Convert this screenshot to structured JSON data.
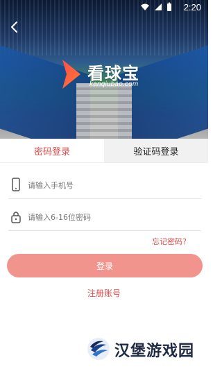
{
  "status_bar": {
    "time": "2:20",
    "icons": [
      "wifi-icon",
      "signal-icon",
      "battery-icon"
    ]
  },
  "header": {
    "back_icon": "chevron-left-icon",
    "brand": {
      "name": "看球宝",
      "domain": "kanqiubao.com",
      "mark_colors": [
        "#ff4d4d",
        "#ff7a2f"
      ]
    }
  },
  "tabs": [
    {
      "label": "密码登录",
      "active": true
    },
    {
      "label": "验证码登录",
      "active": false
    }
  ],
  "form": {
    "phone_placeholder": "请输入手机号",
    "password_placeholder": "请输入6-16位密码",
    "forgot_label": "忘记密码？",
    "login_label": "登录",
    "register_label": "注册账号"
  },
  "watermark": {
    "text": "汉堡游戏园",
    "icon": "swirl-logo-icon"
  },
  "colors": {
    "accent": "#e24b4b",
    "button": "#f2948e",
    "tab_inactive_bg": "#f1f1f1"
  }
}
